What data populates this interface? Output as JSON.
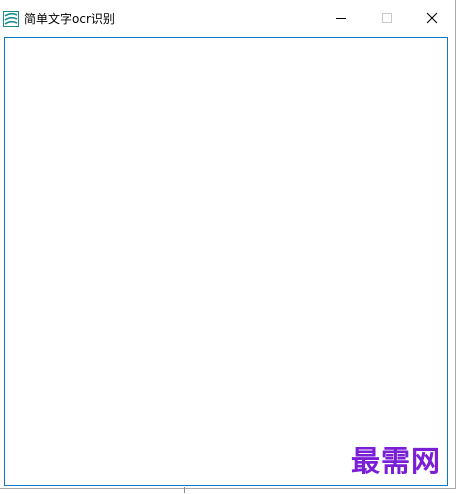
{
  "window": {
    "title": "简单文字ocr识别",
    "app_icon": "app-logo-icon",
    "controls": {
      "minimize_icon": "minimize-icon",
      "maximize_icon": "maximize-icon",
      "close_icon": "close-icon"
    }
  },
  "content": {
    "text": ""
  },
  "watermark": {
    "text": "最需网",
    "color": "#7a1fd6"
  },
  "colors": {
    "content_border": "#0a7ac6",
    "app_icon": "#1a8f8a"
  }
}
